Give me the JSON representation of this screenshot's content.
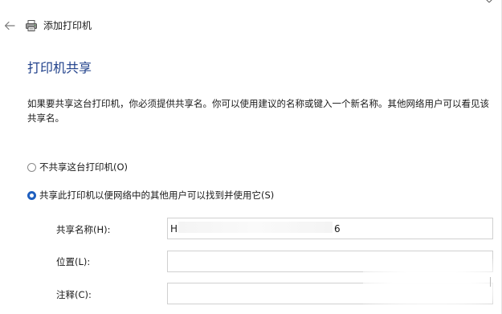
{
  "header": {
    "title": "添加打印机",
    "back_icon": "back-arrow-icon",
    "printer_icon": "printer-icon",
    "close_icon": "close-icon"
  },
  "main": {
    "heading": "打印机共享",
    "description": "如果要共享这台打印机，你必须提供共享名。你可以使用建议的名称或键入一个新名称。其他网络用户可以看见该共享名。",
    "options": [
      {
        "label": "不共享这台打印机(O)",
        "selected": false
      },
      {
        "label": "共享此打印机以便网络中的其他用户可以找到并使用它(S)",
        "selected": true
      }
    ],
    "fields": {
      "share_name": {
        "label": "共享名称(H):",
        "value_prefix": "H",
        "value_suffix": "6"
      },
      "location": {
        "label": "位置(L):",
        "value": ""
      },
      "comment": {
        "label": "注释(C):",
        "value": ""
      }
    }
  },
  "colors": {
    "heading": "#1e3f8a",
    "radio_selected": "#1f5fbf",
    "text": "#1a1a1a",
    "input_border": "#d0d0d0"
  }
}
